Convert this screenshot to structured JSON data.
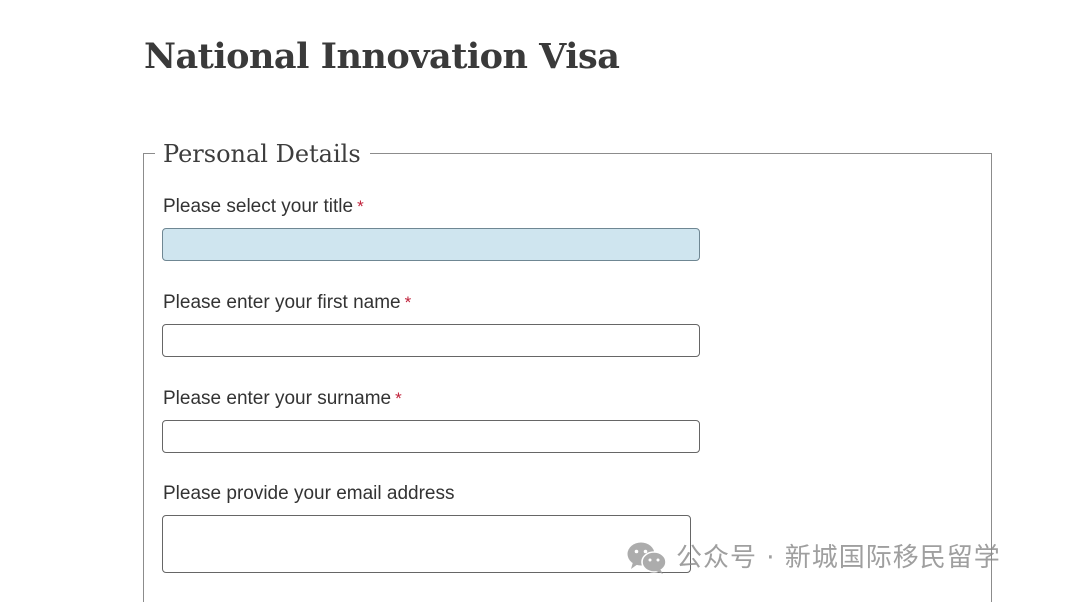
{
  "page": {
    "title": "National Innovation Visa"
  },
  "personal_details": {
    "legend": "Personal Details",
    "fields": [
      {
        "label": "Please select your title",
        "required_marker": "*",
        "type": "select",
        "value": ""
      },
      {
        "label": "Please enter your first name",
        "required_marker": "*",
        "type": "text",
        "value": ""
      },
      {
        "label": "Please enter your surname",
        "required_marker": "*",
        "type": "text",
        "value": ""
      },
      {
        "label": "Please provide your email address",
        "required_marker": "",
        "type": "textarea",
        "value": ""
      }
    ]
  },
  "watermark": {
    "icon": "wechat-icon",
    "text": "公众号 · 新城国际移民留学"
  },
  "colors": {
    "required_star": "#c0213a",
    "select_fill": "#cfe5ef",
    "title_text": "#3a3a3a",
    "border": "#8c8c8c"
  }
}
